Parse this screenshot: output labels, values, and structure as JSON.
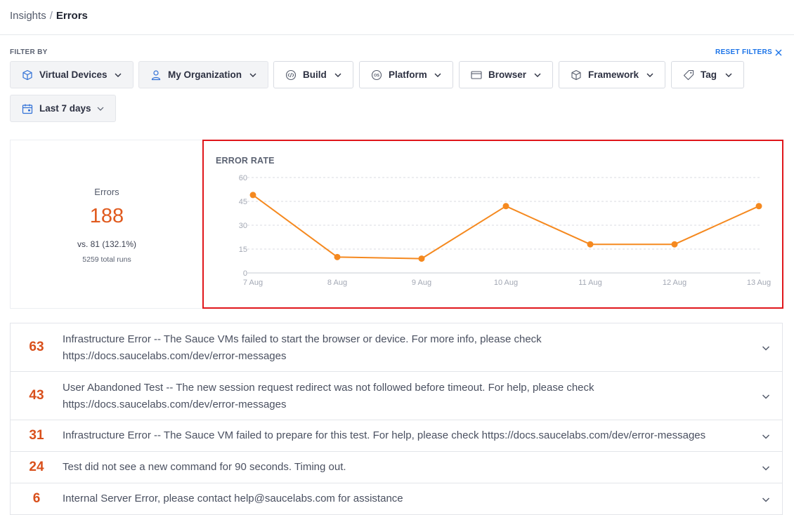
{
  "breadcrumb": {
    "parent": "Insights",
    "separator": "/",
    "current": "Errors"
  },
  "filters": {
    "label": "FILTER BY",
    "reset_label": "RESET FILTERS",
    "buttons": [
      {
        "label": "Virtual Devices",
        "icon": "cube-icon"
      },
      {
        "label": "My Organization",
        "icon": "user-icon"
      },
      {
        "label": "Build",
        "icon": "build-icon"
      },
      {
        "label": "Platform",
        "icon": "os-icon"
      },
      {
        "label": "Browser",
        "icon": "browser-window-icon"
      },
      {
        "label": "Framework",
        "icon": "cube-icon"
      },
      {
        "label": "Tag",
        "icon": "tag-icon"
      },
      {
        "label": "Last 7 days",
        "icon": "calendar-icon"
      }
    ]
  },
  "summary": {
    "label": "Errors",
    "count": "188",
    "comparison": "vs. 81 (132.1%)",
    "total_runs": "5259 total runs"
  },
  "chart_data": {
    "type": "line",
    "title": "ERROR RATE",
    "categories": [
      "7 Aug",
      "8 Aug",
      "9 Aug",
      "10 Aug",
      "11 Aug",
      "12 Aug",
      "13 Aug"
    ],
    "values": [
      49,
      10,
      9,
      42,
      18,
      18,
      42
    ],
    "yticks": [
      0,
      15,
      30,
      45,
      60
    ],
    "ylim": [
      0,
      60
    ],
    "grid": true,
    "colors": {
      "line": "#f5891f",
      "grid": "#d8dbe2",
      "axis": "#c7cbd3",
      "tick_text": "#a3a8b4"
    }
  },
  "errors": [
    {
      "count": "63",
      "message_lines": [
        "Infrastructure Error -- The Sauce VMs failed to start the browser or device. For more info, please check",
        "https://docs.saucelabs.com/dev/error-messages"
      ]
    },
    {
      "count": "43",
      "message_lines": [
        "User Abandoned Test -- The new session request redirect was not followed before timeout. For help, please check",
        "https://docs.saucelabs.com/dev/error-messages"
      ]
    },
    {
      "count": "31",
      "message_lines": [
        "Infrastructure Error -- The Sauce VM failed to prepare for this test. For help, please check https://docs.saucelabs.com/dev/error-messages"
      ]
    },
    {
      "count": "24",
      "message_lines": [
        "Test did not see a new command for 90 seconds. Timing out."
      ]
    },
    {
      "count": "6",
      "message_lines": [
        "Internal Server Error, please contact help@saucelabs.com for assistance"
      ]
    }
  ],
  "colors": {
    "accent_orange": "#e05a1e",
    "link_blue": "#1a73e8",
    "highlight_red": "#e0161b"
  }
}
